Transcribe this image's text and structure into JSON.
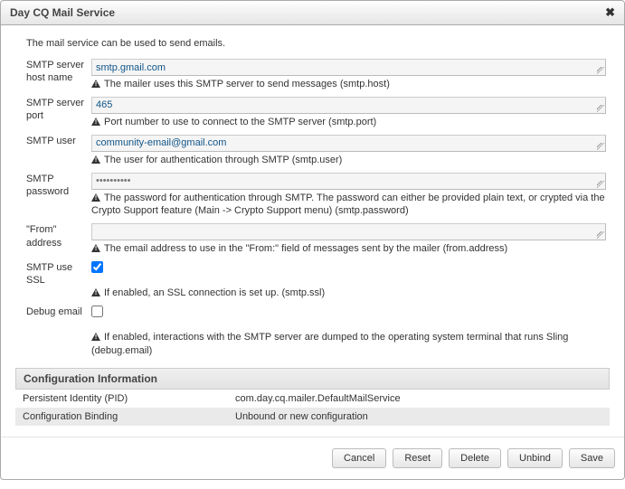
{
  "dialog": {
    "title": "Day CQ Mail Service",
    "description": "The mail service can be used to send emails."
  },
  "fields": {
    "smtpHost": {
      "label": "SMTP server host name",
      "value": "smtp.gmail.com",
      "hint": "The mailer uses this SMTP server to send messages (smtp.host)"
    },
    "smtpPort": {
      "label": "SMTP server port",
      "value": "465",
      "hint": "Port number to use to connect to the SMTP server (smtp.port)"
    },
    "smtpUser": {
      "label": "SMTP user",
      "value": "community-email@gmail.com",
      "hint": "The user for authentication through SMTP (smtp.user)"
    },
    "smtpPassword": {
      "label": "SMTP password",
      "value": "••••••••••",
      "hint": "The password for authentication through SMTP. The password can either be provided plain text, or crypted via the Crypto Support feature (Main -> Crypto Support menu) (smtp.password)"
    },
    "fromAddress": {
      "label": "\"From\" address",
      "value": "",
      "hint": "The email address to use in the \"From:\" field of messages sent by the mailer (from.address)"
    },
    "smtpSsl": {
      "label": "SMTP use SSL",
      "checked": true,
      "hint": "If enabled, an SSL connection is set up. (smtp.ssl)"
    },
    "debugEmail": {
      "label": "Debug email",
      "checked": false,
      "hint": "If enabled, interactions with the SMTP server are dumped to the operating system terminal that runs Sling (debug.email)"
    }
  },
  "configInfo": {
    "header": "Configuration Information",
    "pidLabel": "Persistent Identity (PID)",
    "pidValue": "com.day.cq.mailer.DefaultMailService",
    "bindingLabel": "Configuration Binding",
    "bindingValue": "Unbound or new configuration"
  },
  "buttons": {
    "cancel": "Cancel",
    "reset": "Reset",
    "delete": "Delete",
    "unbind": "Unbind",
    "save": "Save"
  }
}
